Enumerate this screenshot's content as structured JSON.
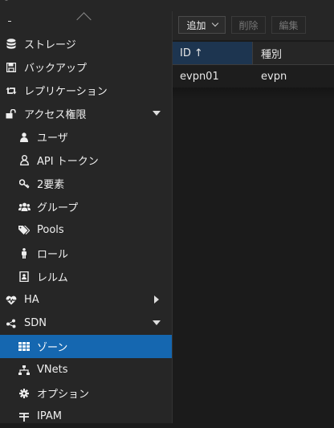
{
  "window": {
    "title_fragment": "-"
  },
  "sidebar": {
    "collapse_label": "-",
    "items": [
      {
        "label": "ストレージ",
        "icon": "database-icon"
      },
      {
        "label": "バックアップ",
        "icon": "save-icon"
      },
      {
        "label": "レプリケーション",
        "icon": "retweet-icon"
      },
      {
        "label": "アクセス権限",
        "icon": "unlock-icon"
      },
      {
        "label": "ユーザ",
        "icon": "user-icon"
      },
      {
        "label": "API トークン",
        "icon": "user-outline-icon"
      },
      {
        "label": "2要素",
        "icon": "key-icon"
      },
      {
        "label": "グループ",
        "icon": "users-icon"
      },
      {
        "label": "Pools",
        "icon": "tags-icon"
      },
      {
        "label": "ロール",
        "icon": "male-icon"
      },
      {
        "label": "レルム",
        "icon": "address-book-icon"
      },
      {
        "label": "HA",
        "icon": "heartbeat-icon"
      },
      {
        "label": "SDN",
        "icon": "sdn-icon"
      },
      {
        "label": "ゾーン",
        "icon": "th-icon"
      },
      {
        "label": "VNets",
        "icon": "sitemap-icon"
      },
      {
        "label": "オプション",
        "icon": "gear-icon"
      },
      {
        "label": "IPAM",
        "icon": "ipam-icon"
      }
    ]
  },
  "toolbar": {
    "add_label": "追加",
    "delete_label": "削除",
    "edit_label": "編集"
  },
  "grid": {
    "columns": [
      "ID",
      "種別"
    ],
    "sort_indicator": "↑",
    "rows": [
      {
        "id": "evpn01",
        "type": "evpn"
      }
    ]
  },
  "colors": {
    "accent": "#1567b0",
    "background": "#1b1b1b",
    "panel": "#262626"
  }
}
